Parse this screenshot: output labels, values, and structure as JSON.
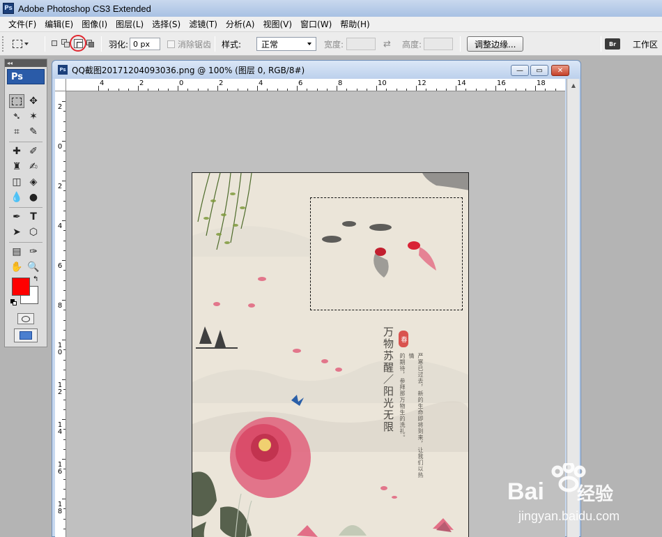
{
  "app": {
    "title": "Adobe Photoshop CS3 Extended",
    "logo": "Ps"
  },
  "menu": [
    "文件(F)",
    "编辑(E)",
    "图像(I)",
    "图层(L)",
    "选择(S)",
    "滤镜(T)",
    "分析(A)",
    "视图(V)",
    "窗口(W)",
    "帮助(H)"
  ],
  "options": {
    "feather_label": "羽化:",
    "feather_value": "0 px",
    "antialias_label": "消除锯齿",
    "style_label": "样式:",
    "style_value": "正常",
    "width_label": "宽度:",
    "height_label": "高度:",
    "refine_edge_button": "调整边缘...",
    "workspace_label": "工作区",
    "bridge_icon": "Br"
  },
  "toolbox": {
    "badge": "Ps",
    "foreground_color": "#ff0000",
    "background_color": "#ffffff"
  },
  "document": {
    "title": "QQ截图20171204093036.png @ 100% (图层 0, RGB/8#)",
    "ruler_top": [
      "4",
      "2",
      "0",
      "2",
      "4",
      "6",
      "8",
      "10",
      "12",
      "14",
      "16",
      "18"
    ],
    "ruler_left": [
      "2",
      "0",
      "2",
      "4",
      "6",
      "8",
      "1\n0",
      "1\n2",
      "1\n4",
      "1\n6",
      "1\n8"
    ]
  },
  "artwork": {
    "title": "万物苏醒／阳光无限",
    "seal": "春",
    "body_col1": "严寒已过去，新的生命即将到来，让我们以热情",
    "body_col2": "的期待，参拜那万物生的洗礼。"
  },
  "watermark": {
    "main": "Bai",
    "sub": "经验",
    "url": "jingyan.baidu.com"
  }
}
